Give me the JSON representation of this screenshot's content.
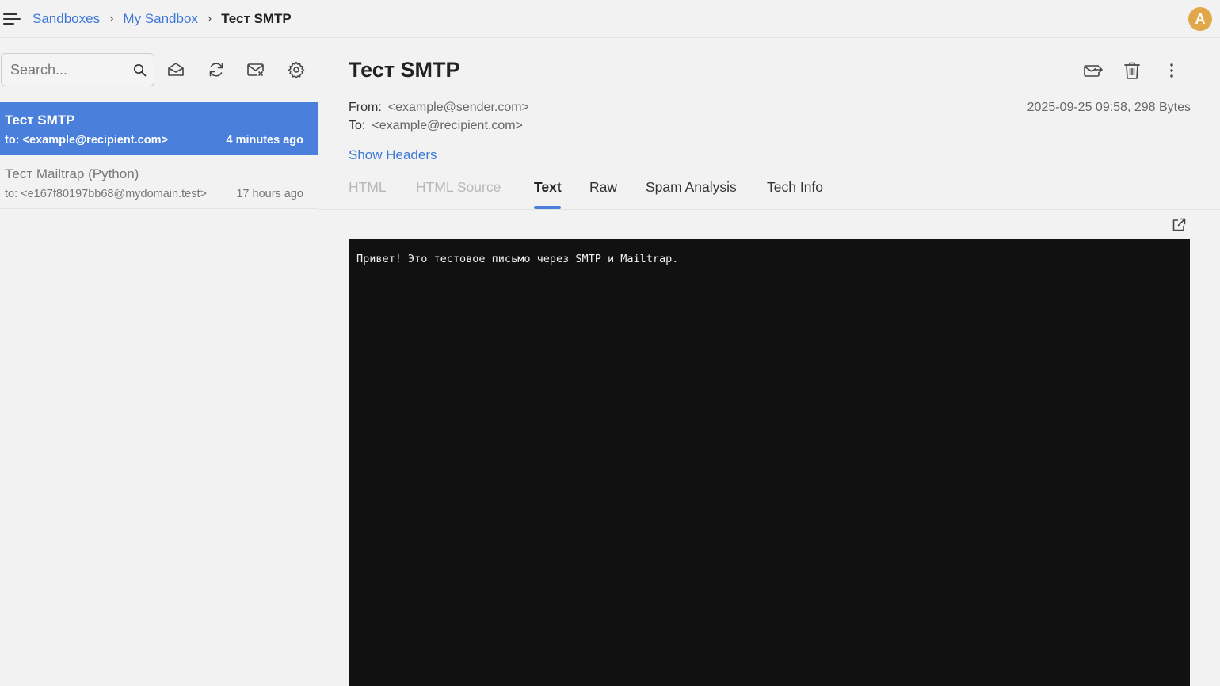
{
  "breadcrumb": {
    "items": [
      "Sandboxes",
      "My Sandbox"
    ],
    "current": "Тест SMTP",
    "separator": "›"
  },
  "user": {
    "avatar_initial": "A",
    "avatar_color": "#e1a84a"
  },
  "sidebar": {
    "search_placeholder": "Search...",
    "tools": [
      "mark-read-icon",
      "refresh-icon",
      "clear-inbox-icon",
      "settings-icon"
    ],
    "messages": [
      {
        "subject": "Тест SMTP",
        "to": "to: <example@recipient.com>",
        "time": "4 minutes ago",
        "selected": true
      },
      {
        "subject": "Тест Mailtrap (Python)",
        "to": "to: <e167f80197bb68@mydomain.test>",
        "time": "17 hours ago",
        "selected": false
      }
    ]
  },
  "message": {
    "subject": "Тест SMTP",
    "from_label": "From:",
    "from": "<example@sender.com>",
    "to_label": "To:",
    "to": "<example@recipient.com>",
    "meta": "2025-09-25 09:58, 298 Bytes",
    "show_headers": "Show Headers",
    "actions": [
      "forward-icon",
      "trash-icon",
      "more-icon"
    ],
    "body_text": "Привет! Это тестовое письмо через SMTP и Mailtrap."
  },
  "tabs": [
    {
      "label": "HTML",
      "state": "disabled"
    },
    {
      "label": "HTML Source",
      "state": "disabled"
    },
    {
      "label": "Text",
      "state": "active"
    },
    {
      "label": "Raw",
      "state": "normal"
    },
    {
      "label": "Spam Analysis",
      "state": "normal"
    },
    {
      "label": "Tech Info",
      "state": "normal"
    }
  ],
  "colors": {
    "accent": "#4a7fdc",
    "link": "#3d78d8",
    "code_bg": "#111111"
  }
}
